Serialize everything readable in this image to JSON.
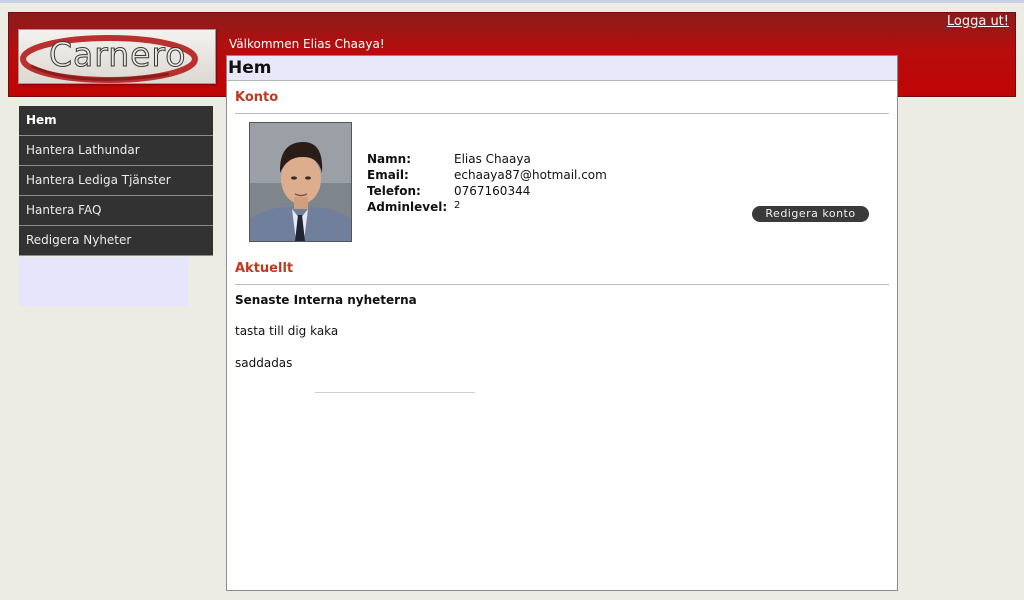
{
  "header": {
    "logo_text": "Carnero",
    "welcome": "Välkommen Elias Chaaya!",
    "logout_label": "Logga ut!"
  },
  "sidebar": {
    "items": [
      {
        "label": "Hem",
        "active": true
      },
      {
        "label": "Hantera Lathundar"
      },
      {
        "label": "Hantera Lediga Tjänster"
      },
      {
        "label": "Hantera FAQ"
      },
      {
        "label": "Redigera Nyheter"
      }
    ]
  },
  "main": {
    "title": "Hem",
    "account": {
      "heading": "Konto",
      "fields": [
        {
          "label": "Namn:",
          "value": "Elias Chaaya"
        },
        {
          "label": "Email:",
          "value": "echaaya87@hotmail.com"
        },
        {
          "label": "Telefon:",
          "value": "0767160344"
        },
        {
          "label": "Adminlevel:",
          "value": "2"
        }
      ],
      "edit_label": "Redigera konto"
    },
    "news": {
      "heading": "Aktuellt",
      "subheading": "Senaste Interna nyheterna",
      "items": [
        "tasta till dig kaka",
        "saddadas"
      ]
    }
  },
  "colors": {
    "header_red": "#c00404",
    "nav_bg": "#323232",
    "section_title": "#c0391e",
    "title_bar": "#e8e8fa"
  }
}
